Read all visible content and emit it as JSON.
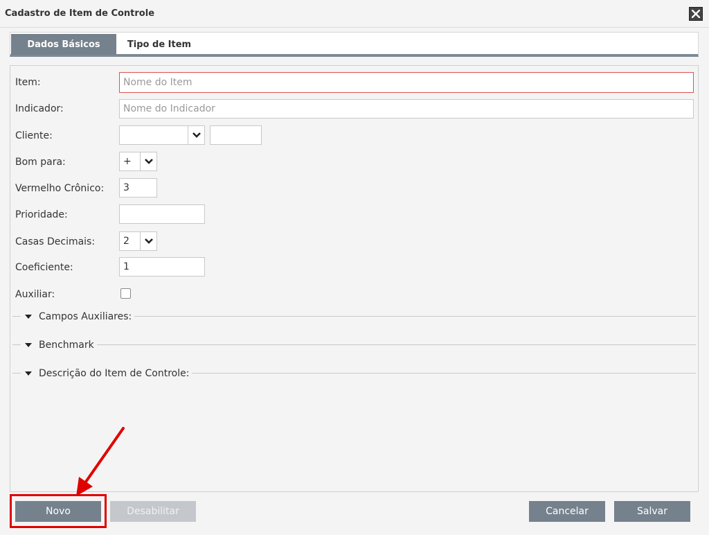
{
  "window": {
    "title": "Cadastro de Item de Controle",
    "close_icon": "close-icon"
  },
  "tabs": [
    {
      "label": "Dados Básicos",
      "active": true
    },
    {
      "label": "Tipo de Item",
      "active": false
    }
  ],
  "form": {
    "item": {
      "label": "Item:",
      "placeholder": "Nome do Item",
      "value": ""
    },
    "indicador": {
      "label": "Indicador:",
      "placeholder": "Nome do Indicador",
      "value": ""
    },
    "cliente": {
      "label": "Cliente:",
      "value": "",
      "code": ""
    },
    "bom_para": {
      "label": "Bom para:",
      "value": "+"
    },
    "vermelho_cronico": {
      "label": "Vermelho Crônico:",
      "value": "3"
    },
    "prioridade": {
      "label": "Prioridade:",
      "value": ""
    },
    "casas_decimais": {
      "label": "Casas Decimais:",
      "value": "2"
    },
    "coeficiente": {
      "label": "Coeficiente:",
      "value": "1"
    },
    "auxiliar": {
      "label": "Auxiliar:",
      "checked": false
    }
  },
  "sections": [
    {
      "label": "Campos Auxiliares:"
    },
    {
      "label": "Benchmark"
    },
    {
      "label": "Descrição do Item de Controle:"
    }
  ],
  "buttons": {
    "novo": "Novo",
    "desabilitar": "Desabilitar",
    "cancelar": "Cancelar",
    "salvar": "Salvar"
  },
  "colors": {
    "accent": "#75818c",
    "error_border": "#d9534f",
    "annotation": "#e00000"
  }
}
